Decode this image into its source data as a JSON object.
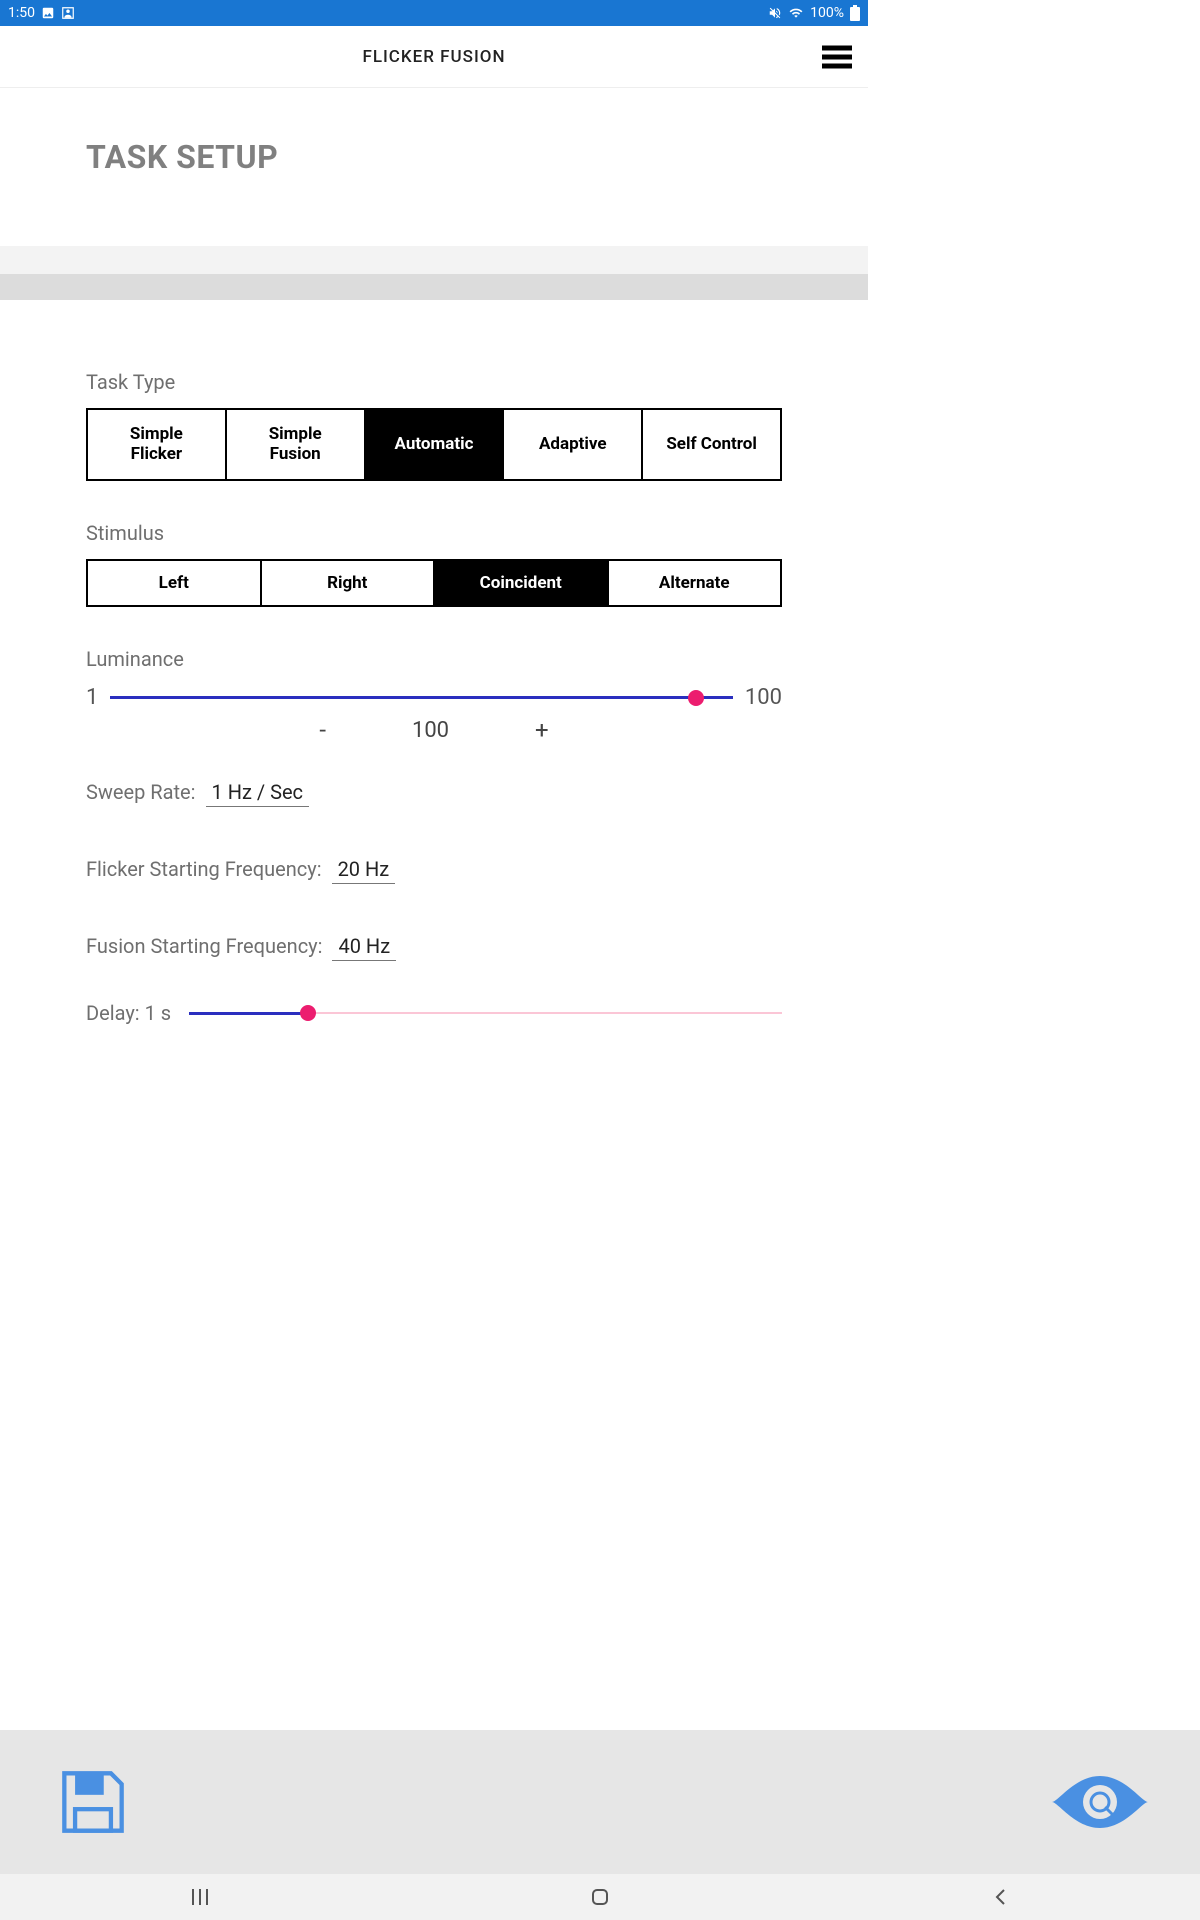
{
  "status": {
    "time": "1:50",
    "battery": "100%"
  },
  "header": {
    "title": "FLICKER FUSION"
  },
  "page": {
    "title": "TASK SETUP"
  },
  "task_type": {
    "label": "Task Type",
    "options": [
      "Simple Flicker",
      "Simple Fusion",
      "Automatic",
      "Adaptive",
      "Self Control"
    ],
    "selected_index": 2
  },
  "stimulus": {
    "label": "Stimulus",
    "options": [
      "Left",
      "Right",
      "Coincident",
      "Alternate"
    ],
    "selected_index": 2
  },
  "luminance": {
    "label": "Luminance",
    "min": "1",
    "max": "100",
    "value": "100",
    "minus": "-",
    "plus": "+"
  },
  "sweep_rate": {
    "label": "Sweep Rate:",
    "value": "1 Hz / Sec"
  },
  "flicker_start": {
    "label": "Flicker Starting Frequency:",
    "value": "20 Hz"
  },
  "fusion_start": {
    "label": "Fusion Starting Frequency:",
    "value": "40 Hz"
  },
  "delay": {
    "label": "Delay: 1 s"
  }
}
